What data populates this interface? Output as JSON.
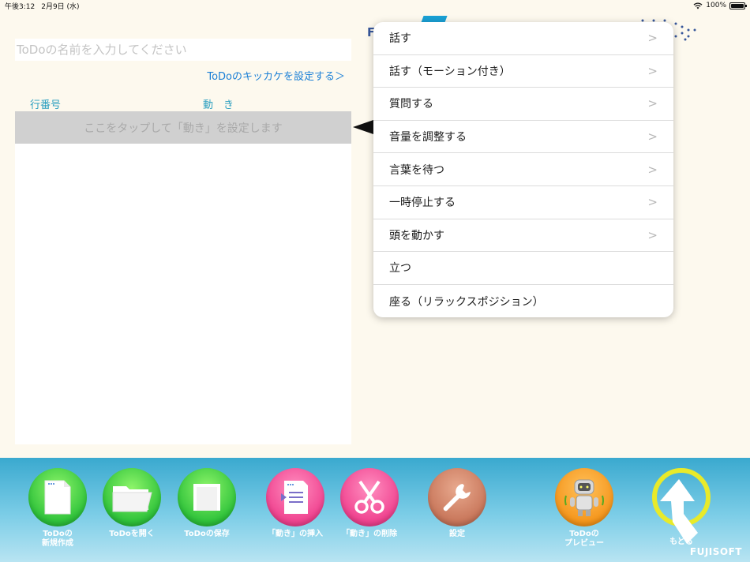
{
  "status_bar": {
    "time": "午後3:12",
    "date": "2月9日 (水)",
    "battery_percent": "100%",
    "battery_level": 1.0
  },
  "editor": {
    "name_placeholder": "ToDoの名前を入力してください",
    "trigger_link": "ToDoのキッカケを設定する＞",
    "col_line_number": "行番号",
    "col_action": "動　き",
    "tap_row_text": "ここをタップして「動き」を設定します"
  },
  "background_logo": {
    "text": "F"
  },
  "menu": {
    "items": [
      {
        "label": "話す",
        "has_submenu": true
      },
      {
        "label": "話す（モーション付き）",
        "has_submenu": true
      },
      {
        "label": "質問する",
        "has_submenu": true
      },
      {
        "label": "音量を調整する",
        "has_submenu": true
      },
      {
        "label": "言葉を待つ",
        "has_submenu": true
      },
      {
        "label": "一時停止する",
        "has_submenu": true
      },
      {
        "label": "頭を動かす",
        "has_submenu": true
      },
      {
        "label": "立つ",
        "has_submenu": false
      },
      {
        "label": "座る（リラックスポジション）",
        "has_submenu": false
      }
    ],
    "chevron": ">"
  },
  "toolbar": {
    "new_todo": "ToDoの\n新規作成",
    "open_todo": "ToDoを開く",
    "save_todo": "ToDoの保存",
    "insert_action": "「動き」の挿入",
    "delete_action": "「動き」の削除",
    "settings": "設定",
    "preview": "ToDoの\nプレビュー",
    "back": "もどる",
    "brand": "FUJISOFT"
  },
  "colors": {
    "accent_link": "#1a7fd6",
    "header_text": "#2c9fc0",
    "toolbar_top": "#3aa9cf",
    "green_button": "#2ec23a",
    "pink_button": "#f0428f",
    "brown_button": "#c8765a",
    "orange_button": "#f5961c",
    "back_ring": "#e8ea2a"
  }
}
